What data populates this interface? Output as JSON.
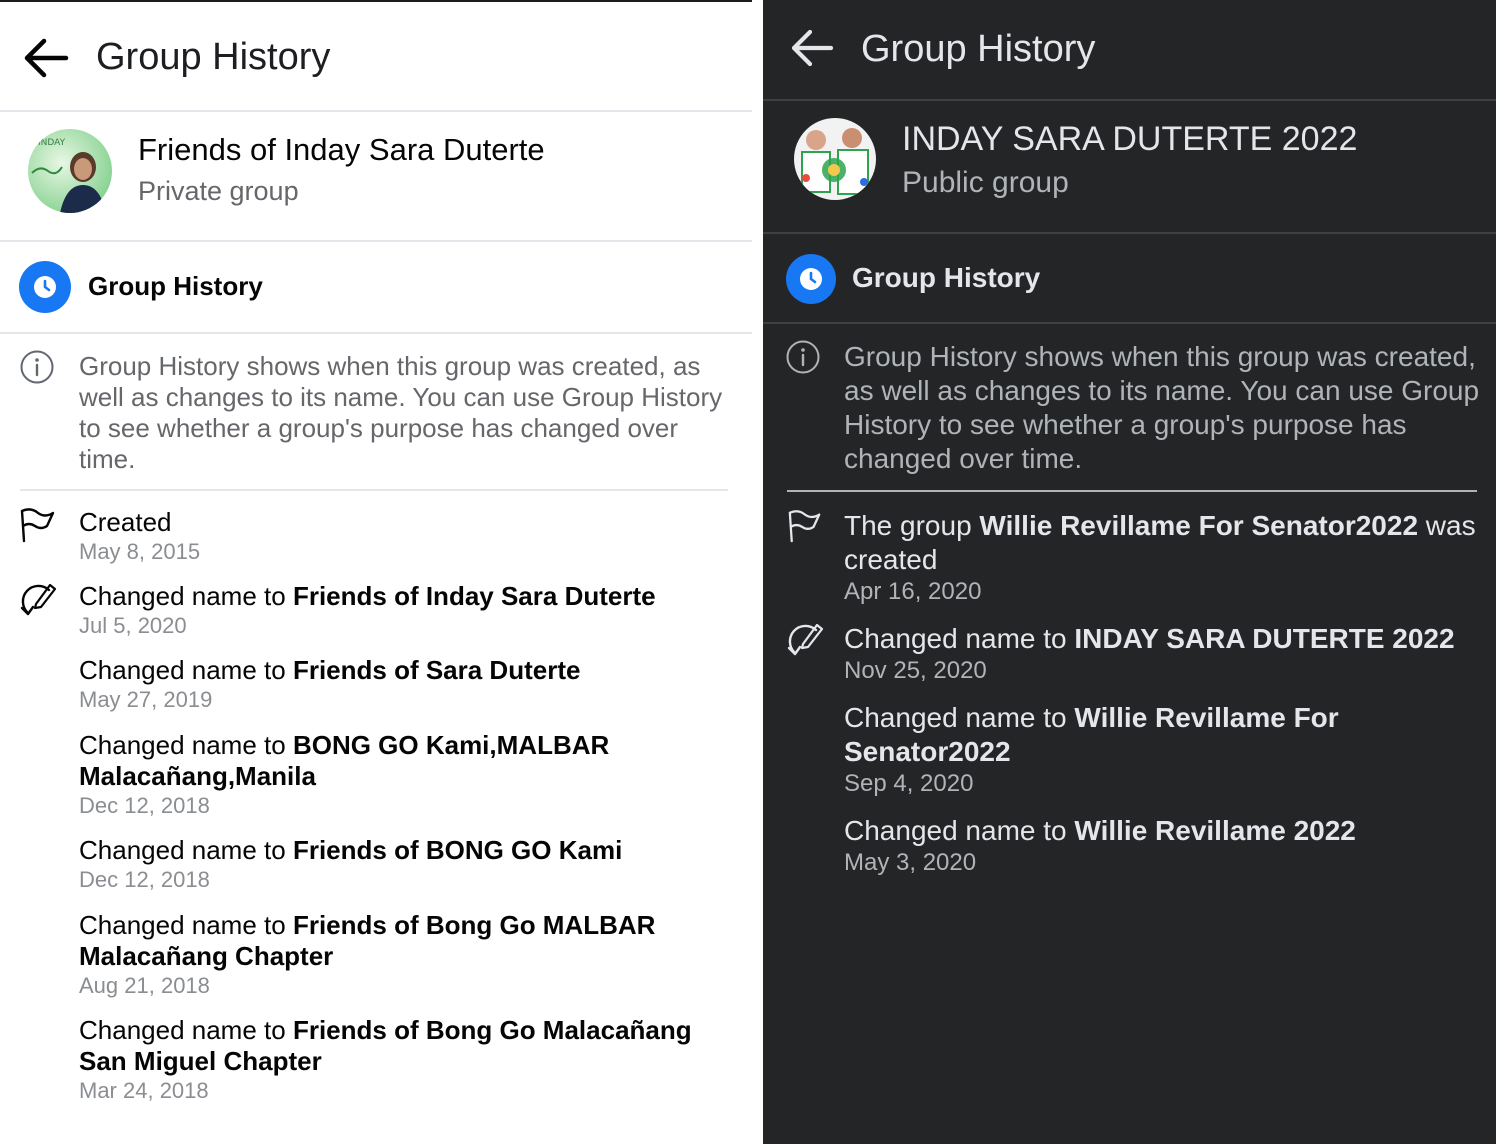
{
  "light": {
    "header_title": "Group History",
    "group": {
      "name": "Friends of Inday Sara Duterte",
      "type": "Private group",
      "avatar_text": "INDAY"
    },
    "section_title": "Group History",
    "info": "Group History shows when this group was created, as well as changes to its name. You can use Group History to see whether a group's purpose has changed over time.",
    "created": {
      "label": "Created",
      "date": "May 8, 2015"
    },
    "changes": [
      {
        "prefix": "Changed name to ",
        "name": "Friends of Inday Sara Duterte",
        "date": "Jul 5, 2020"
      },
      {
        "prefix": "Changed name to ",
        "name": "Friends of Sara Duterte",
        "date": "May 27, 2019"
      },
      {
        "prefix": "Changed name to ",
        "name": "BONG GO Kami,MALBAR Malacañang,Manila",
        "date": "Dec 12, 2018"
      },
      {
        "prefix": "Changed name to ",
        "name": "Friends of BONG GO Kami",
        "date": "Dec 12, 2018"
      },
      {
        "prefix": "Changed name to ",
        "name": "Friends of Bong Go MALBAR Malacañang Chapter",
        "date": "Aug 21, 2018"
      },
      {
        "prefix": "Changed name to ",
        "name": "Friends of Bong Go Malacañang San Miguel Chapter",
        "date": "Mar 24, 2018"
      }
    ]
  },
  "dark": {
    "header_title": "Group History",
    "group": {
      "name": "INDAY SARA DUTERTE 2022",
      "type": "Public group"
    },
    "section_title": "Group History",
    "info": "Group History shows when this group was created, as well as changes to its name. You can use Group History to see whether a group's purpose has changed over time.",
    "created": {
      "prefix": "The group ",
      "name": "Willie Revillame For Senator2022",
      "suffix": " was created",
      "date": "Apr 16, 2020"
    },
    "changes": [
      {
        "prefix": "Changed name to ",
        "name": "INDAY SARA DUTERTE 2022",
        "date": "Nov 25, 2020"
      },
      {
        "prefix": "Changed name to ",
        "name": "Willie Revillame For Senator2022",
        "date": "Sep 4, 2020"
      },
      {
        "prefix": "Changed name to ",
        "name": "Willie Revillame 2022",
        "date": "May 3, 2020"
      }
    ]
  },
  "colors": {
    "accent": "#1877f2",
    "dark_bg": "#242526",
    "light_bg": "#ffffff"
  },
  "icons": [
    "back-arrow-icon",
    "clock-icon",
    "info-icon",
    "flag-icon",
    "edit-name-icon"
  ]
}
